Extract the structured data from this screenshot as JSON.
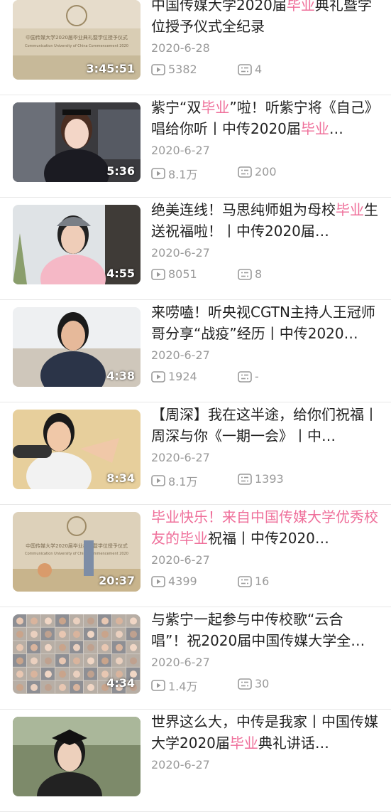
{
  "videos": [
    {
      "title_parts": [
        {
          "text": "中国传媒大学2020届",
          "hl": false
        },
        {
          "text": "毕业",
          "hl": true
        },
        {
          "text": "典礼暨学位授予仪式全纪录",
          "hl": false
        }
      ],
      "date": "2020-6-28",
      "duration": "3:45:51",
      "views": "5382",
      "danmu": "4",
      "thumb": "ceremony"
    },
    {
      "title_parts": [
        {
          "text": "紫宁“双",
          "hl": false
        },
        {
          "text": "毕业",
          "hl": true
        },
        {
          "text": "”啦！听紫宁将《自己》唱给你听丨中传2020届",
          "hl": false
        },
        {
          "text": "毕业",
          "hl": true
        },
        {
          "text": "…",
          "hl": false
        }
      ],
      "date": "2020-6-27",
      "duration": "5:36",
      "views": "8.1万",
      "danmu": "200",
      "thumb": "gown_girl"
    },
    {
      "title_parts": [
        {
          "text": "绝美连线！马思纯师姐为母校",
          "hl": false
        },
        {
          "text": "毕业",
          "hl": true
        },
        {
          "text": "生送祝福啦！丨中传2020届…",
          "hl": false
        }
      ],
      "date": "2020-6-27",
      "duration": "4:55",
      "views": "8051",
      "danmu": "8",
      "thumb": "cap_girl"
    },
    {
      "title_parts": [
        {
          "text": "来唠嗑！听央视CGTN主持人王冠师哥分享“战疫”经历丨中传2020…",
          "hl": false
        }
      ],
      "date": "2020-6-27",
      "duration": "4:38",
      "views": "1924",
      "danmu": "-",
      "thumb": "man_sofa"
    },
    {
      "title_parts": [
        {
          "text": "【周深】我在这半途，给你们祝福丨周深与你《一期一会》丨中…",
          "hl": false
        }
      ],
      "date": "2020-6-27",
      "duration": "8:34",
      "views": "8.1万",
      "danmu": "1393",
      "thumb": "singer_mic"
    },
    {
      "title_parts": [
        {
          "text": "毕业快乐！来自中国传媒大学优秀校友的毕业",
          "hl": true
        },
        {
          "text": "祝福丨中传2020…",
          "hl": false
        }
      ],
      "date": "2020-6-27",
      "duration": "20:37",
      "views": "4399",
      "danmu": "16",
      "thumb": "ceremony_cartoon"
    },
    {
      "title_parts": [
        {
          "text": "与紫宁一起参与中传校歌“云合唱”！祝2020届中国传媒大学全…",
          "hl": false
        }
      ],
      "date": "2020-6-27",
      "duration": "4:34",
      "views": "1.4万",
      "danmu": "30",
      "thumb": "grid_faces"
    },
    {
      "title_parts": [
        {
          "text": "世界这么大，中传是我家丨中国传媒大学2020届",
          "hl": false
        },
        {
          "text": "毕业",
          "hl": true
        },
        {
          "text": "典礼讲话…",
          "hl": false
        }
      ],
      "date": "2020-6-27",
      "duration": "",
      "views": "",
      "danmu": "",
      "thumb": "grad_man"
    }
  ],
  "thumb_text": {
    "banner_cn": "中国传媒大学2020届毕业典礼暨学位授予仪式",
    "banner_en": "Communication University of China Commencement 2020"
  },
  "colors": {
    "highlight": "#ef6f9a",
    "meta": "#9a9a9a",
    "title": "#222222"
  },
  "icons": {
    "views": "play-count-icon",
    "danmu": "danmaku-icon"
  }
}
